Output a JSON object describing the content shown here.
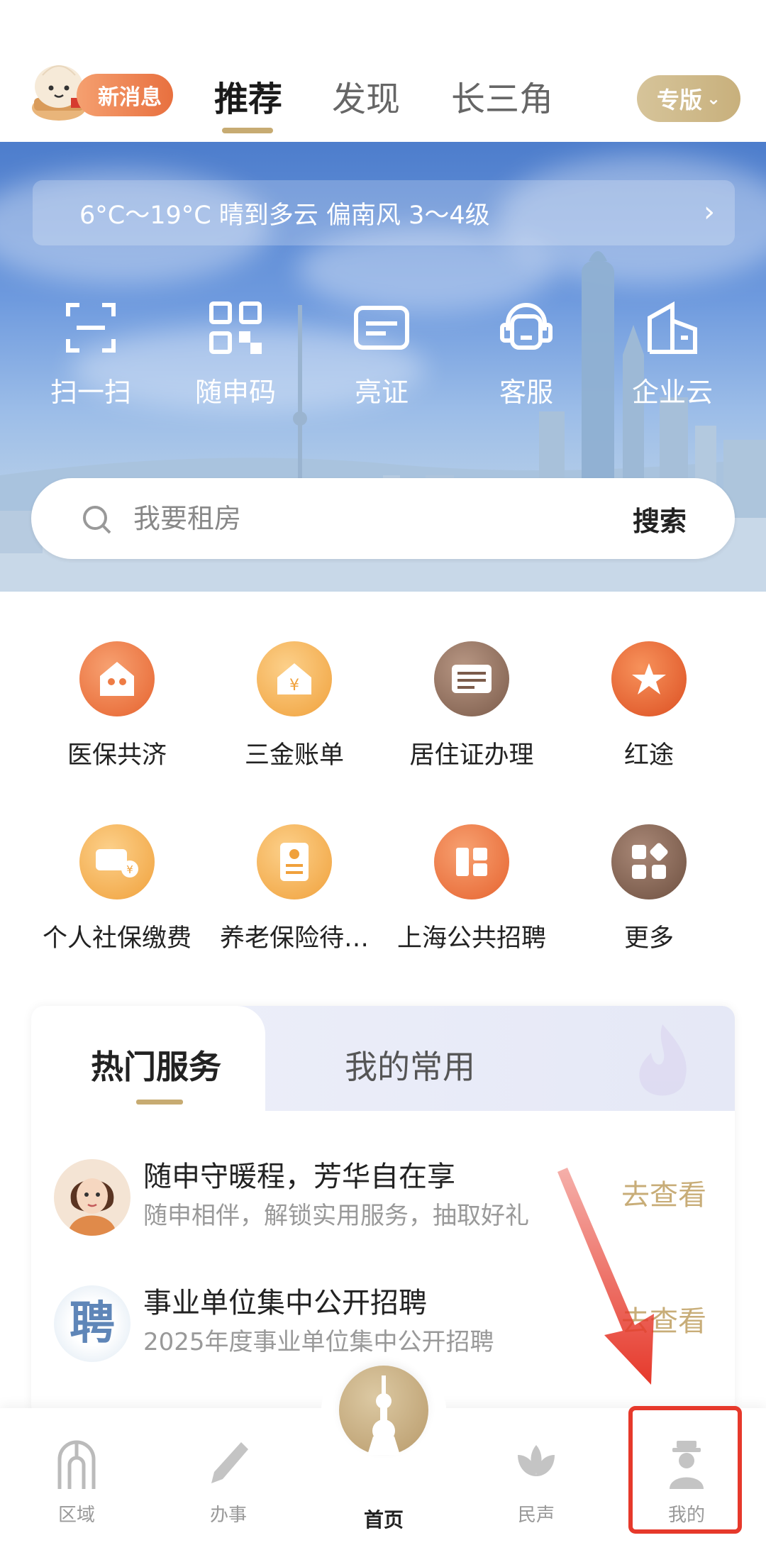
{
  "header": {
    "new_message_label": "新消息",
    "tabs": [
      {
        "label": "推荐",
        "active": true
      },
      {
        "label": "发现",
        "active": false
      },
      {
        "label": "长三角",
        "active": false
      }
    ],
    "edition_label": "专版",
    "accent_color": "#c7ab72"
  },
  "hero": {
    "weather": "6°C～19°C 晴到多云 偏南风 3～4级",
    "quick_actions": [
      {
        "label": "扫一扫",
        "icon": "scan-icon"
      },
      {
        "label": "随申码",
        "icon": "qr-code-icon"
      },
      {
        "label": "亮证",
        "icon": "card-icon"
      },
      {
        "label": "客服",
        "icon": "customer-service-icon"
      },
      {
        "label": "企业云",
        "icon": "building-icon"
      }
    ],
    "search": {
      "placeholder": "我要租房",
      "button": "搜索"
    }
  },
  "services": [
    {
      "label": "医保共济",
      "icon": "family-house-icon",
      "color": "#ee7c45"
    },
    {
      "label": "三金账单",
      "icon": "yuan-house-icon",
      "color": "#f4b25a"
    },
    {
      "label": "居住证办理",
      "icon": "residence-card-icon",
      "color": "#8d6e5c"
    },
    {
      "label": "红途",
      "icon": "star-icon",
      "color": "#e9602f"
    },
    {
      "label": "个人社保缴费",
      "icon": "pay-social-insurance-icon",
      "color": "#f4b25a"
    },
    {
      "label": "养老保险待…",
      "icon": "pension-doc-icon",
      "color": "#f4b25a"
    },
    {
      "label": "上海公共招聘",
      "icon": "recruit-icon",
      "color": "#ee7c45"
    },
    {
      "label": "更多",
      "icon": "more-grid-icon",
      "color": "#8d6e5c"
    }
  ],
  "service_card": {
    "tabs": [
      {
        "label": "热门服务",
        "active": true
      },
      {
        "label": "我的常用",
        "active": false
      }
    ],
    "rows": [
      {
        "title": "随申守暖程，芳华自在享",
        "subtitle": "随申相伴，解锁实用服务，抽取好礼",
        "link": "去查看"
      },
      {
        "title": "事业单位集中公开招聘",
        "subtitle": "2025年度事业单位集中公开招聘",
        "link": "去查看",
        "avatar_text": "聘"
      }
    ]
  },
  "bottom_nav": {
    "items": [
      {
        "label": "区域",
        "icon": "region-icon"
      },
      {
        "label": "办事",
        "icon": "pen-icon"
      },
      {
        "label": "首页",
        "icon": "tower-icon",
        "active": true
      },
      {
        "label": "民声",
        "icon": "flower-icon"
      },
      {
        "label": "我的",
        "icon": "person-icon"
      }
    ]
  },
  "annotation": {
    "color": "#e6392b"
  }
}
